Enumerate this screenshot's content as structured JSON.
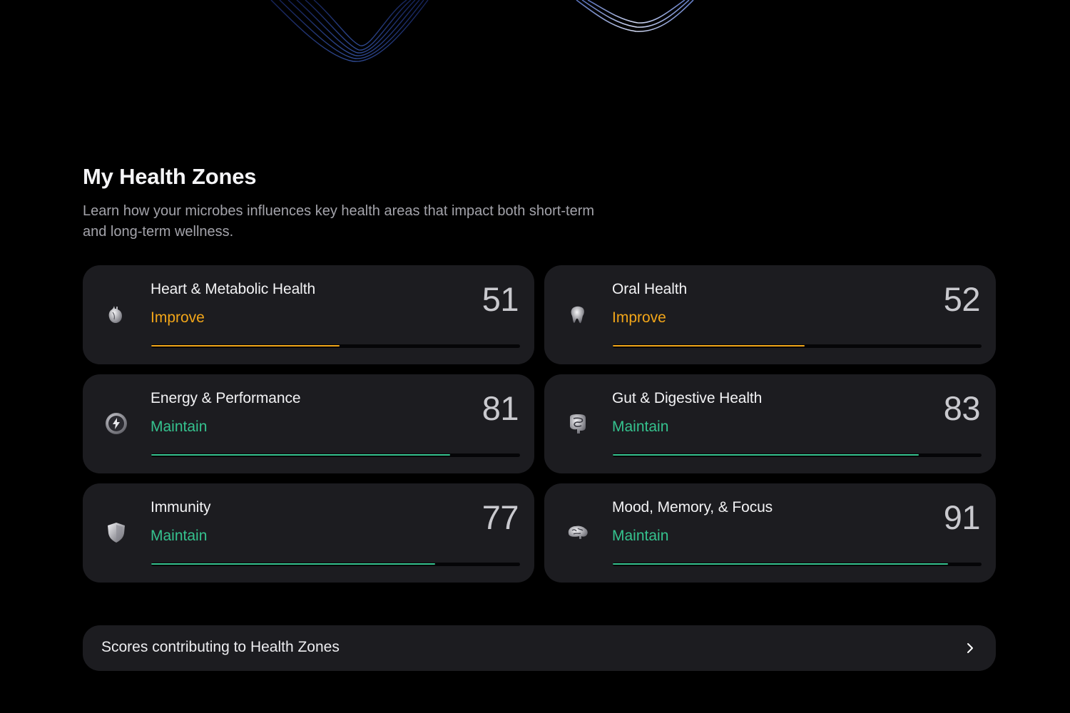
{
  "colors": {
    "background": "#000000",
    "card": "#1c1c20",
    "improve": "#f2a619",
    "maintain": "#35c28e",
    "track": "#050507"
  },
  "section": {
    "title": "My Health Zones",
    "description": "Learn how your microbes influences key health areas that impact both short-term and long-term wellness."
  },
  "zones": [
    {
      "name": "Heart & Metabolic Health",
      "status": "Improve",
      "score": "51",
      "progress": 0.51,
      "icon": "heart-icon"
    },
    {
      "name": "Oral Health",
      "status": "Improve",
      "score": "52",
      "progress": 0.52,
      "icon": "tooth-icon"
    },
    {
      "name": "Energy & Performance",
      "status": "Maintain",
      "score": "81",
      "progress": 0.81,
      "icon": "lightning-icon"
    },
    {
      "name": "Gut & Digestive Health",
      "status": "Maintain",
      "score": "83",
      "progress": 0.83,
      "icon": "intestine-icon"
    },
    {
      "name": "Immunity",
      "status": "Maintain",
      "score": "77",
      "progress": 0.77,
      "icon": "shield-icon"
    },
    {
      "name": "Mood, Memory, & Focus",
      "status": "Maintain",
      "score": "91",
      "progress": 0.91,
      "icon": "brain-icon"
    }
  ],
  "scores_link": {
    "label": "Scores contributing to Health Zones",
    "icon": "chevron-right-icon"
  }
}
